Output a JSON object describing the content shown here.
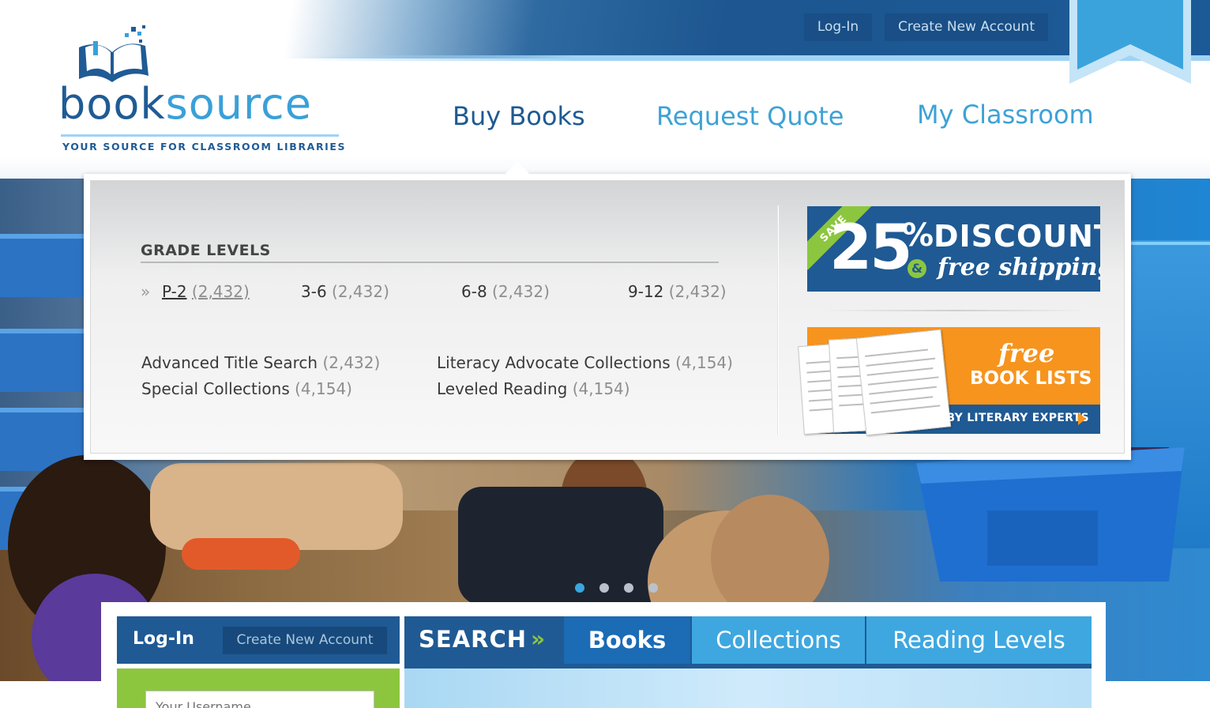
{
  "header": {
    "login_label": "Log-In",
    "create_account_label": "Create New Account"
  },
  "logo": {
    "word_part1": "book",
    "word_part2": "source",
    "tagline": "YOUR SOURCE FOR CLASSROOM LIBRARIES"
  },
  "nav": {
    "items": [
      {
        "label": "Buy Books",
        "active": true
      },
      {
        "label": "Request Quote",
        "active": false
      },
      {
        "label": "My Classroom",
        "active": false
      }
    ]
  },
  "dropdown": {
    "heading": "GRADE LEVELS",
    "grade_marker": "»",
    "grades": [
      {
        "label": "P-2",
        "count": "(2,432)",
        "selected": true
      },
      {
        "label": "3-6",
        "count": "(2,432)",
        "selected": false
      },
      {
        "label": "6-8",
        "count": "(2,432)",
        "selected": false
      },
      {
        "label": "9-12",
        "count": "(2,432)",
        "selected": false
      }
    ],
    "links": [
      {
        "label": "Advanced Title Search",
        "count": "(2,432)"
      },
      {
        "label": "Special Collections",
        "count": "(4,154)"
      },
      {
        "label": "Literacy Advocate Collections",
        "count": "(4,154)"
      },
      {
        "label": "Leveled Reading",
        "count": "(4,154)"
      }
    ]
  },
  "promos": {
    "discount": {
      "ribbon": "SAVE",
      "number": "25",
      "percent": "%",
      "discount_word": "DISCOUNT",
      "ampersand": "&",
      "free_shipping": "free shipping!"
    },
    "book_lists": {
      "free": "free",
      "book_lists": "BOOK LISTS",
      "created_by": "CREATED BY LITERARY EXPERTS"
    }
  },
  "carousel": {
    "slide_count": 4,
    "active_index": 0
  },
  "bottom": {
    "login_title": "Log-In",
    "create_account_label": "Create New Account",
    "username_placeholder": "Your Username"
  },
  "search": {
    "label": "SEARCH",
    "arrows": "»",
    "tabs": [
      {
        "label": "Books",
        "active": true
      },
      {
        "label": "Collections",
        "active": false
      },
      {
        "label": "Reading Levels",
        "active": false
      }
    ]
  },
  "colors": {
    "brand_dark_blue": "#1f5a94",
    "brand_light_blue": "#3ea2d6",
    "accent_green": "#8cc63f",
    "accent_orange": "#f7941d"
  }
}
